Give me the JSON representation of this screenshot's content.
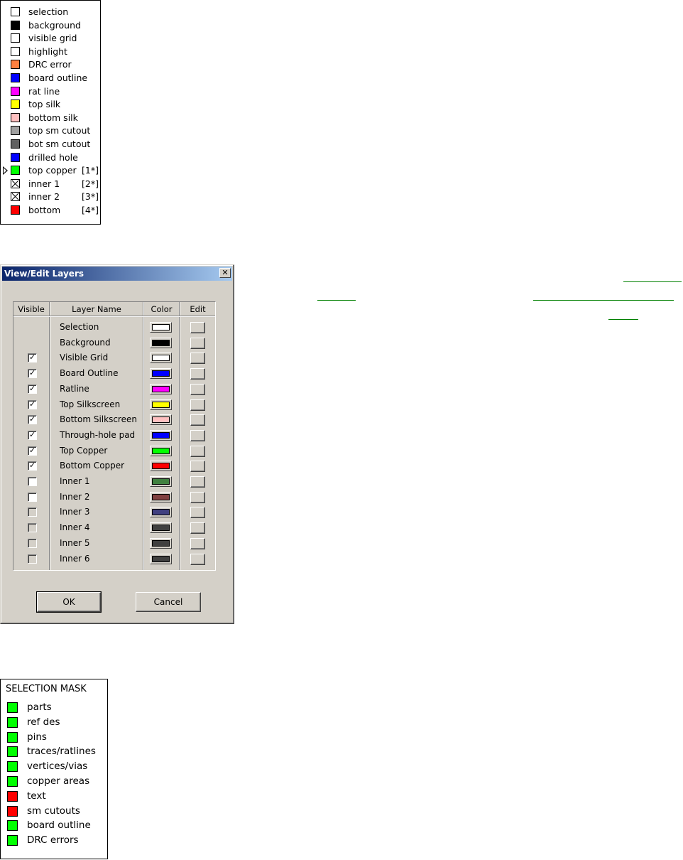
{
  "layers_legend": {
    "items": [
      {
        "label": "selection",
        "color": "#ffffff",
        "icon": "empty-swatch",
        "index": ""
      },
      {
        "label": "background",
        "color": "#000000",
        "icon": "color-swatch",
        "index": ""
      },
      {
        "label": "visible grid",
        "color": "#ffffff",
        "icon": "empty-swatch",
        "index": ""
      },
      {
        "label": "highlight",
        "color": "#ffffff",
        "icon": "empty-swatch",
        "index": ""
      },
      {
        "label": "DRC error",
        "color": "#ff8040",
        "icon": "color-swatch",
        "index": ""
      },
      {
        "label": "board outline",
        "color": "#0000ff",
        "icon": "color-swatch",
        "index": ""
      },
      {
        "label": "rat line",
        "color": "#ff00ff",
        "icon": "color-swatch",
        "index": ""
      },
      {
        "label": "top silk",
        "color": "#ffff00",
        "icon": "color-swatch",
        "index": ""
      },
      {
        "label": "bottom silk",
        "color": "#ffc0c0",
        "icon": "color-swatch",
        "index": ""
      },
      {
        "label": "top sm cutout",
        "color": "#a0a0a0",
        "icon": "color-swatch",
        "index": ""
      },
      {
        "label": "bot sm cutout",
        "color": "#606060",
        "icon": "color-swatch",
        "index": ""
      },
      {
        "label": "drilled hole",
        "color": "#0000ff",
        "icon": "color-swatch",
        "index": ""
      },
      {
        "label": "top copper",
        "color": "#00ff00",
        "icon": "color-swatch",
        "index": "[1*]",
        "active": true
      },
      {
        "label": "inner 1",
        "color": "#ffffff",
        "icon": "crossed-swatch",
        "index": "[2*]"
      },
      {
        "label": "inner 2",
        "color": "#ffffff",
        "icon": "crossed-swatch",
        "index": "[3*]"
      },
      {
        "label": "bottom",
        "color": "#ff0000",
        "icon": "color-swatch",
        "index": "[4*]"
      }
    ]
  },
  "dialog": {
    "title": "View/Edit Layers",
    "close_icon": "close-icon",
    "columns": {
      "visible": "Visible",
      "layer_name": "Layer Name",
      "color": "Color",
      "edit": "Edit"
    },
    "rows": [
      {
        "name": "Selection",
        "visible": null,
        "color": "#ffffff"
      },
      {
        "name": "Background",
        "visible": null,
        "color": "#000000"
      },
      {
        "name": "Visible Grid",
        "visible": true,
        "color": "#ffffff"
      },
      {
        "name": "Board Outline",
        "visible": true,
        "color": "#0000ff"
      },
      {
        "name": "Ratline",
        "visible": true,
        "color": "#ff00ff"
      },
      {
        "name": "Top Silkscreen",
        "visible": true,
        "color": "#ffff00"
      },
      {
        "name": "Bottom Silkscreen",
        "visible": true,
        "color": "#ffc0c0"
      },
      {
        "name": "Through-hole pad",
        "visible": true,
        "color": "#0000ff"
      },
      {
        "name": "Top Copper",
        "visible": true,
        "color": "#00ff00"
      },
      {
        "name": "Bottom Copper",
        "visible": true,
        "color": "#ff0000"
      },
      {
        "name": "Inner 1",
        "visible": false,
        "color": "#408040",
        "enabled": true
      },
      {
        "name": "Inner 2",
        "visible": false,
        "color": "#804040",
        "enabled": true
      },
      {
        "name": "Inner 3",
        "visible": false,
        "color": "#404080",
        "enabled": false
      },
      {
        "name": "Inner 4",
        "visible": false,
        "color": "#404040",
        "enabled": false
      },
      {
        "name": "Inner 5",
        "visible": false,
        "color": "#404040",
        "enabled": false
      },
      {
        "name": "Inner 6",
        "visible": false,
        "color": "#404040",
        "enabled": false
      }
    ],
    "ok_label": "OK",
    "cancel_label": "Cancel"
  },
  "selection_mask": {
    "title": "SELECTION MASK",
    "items": [
      {
        "label": "parts",
        "color": "#00ff00"
      },
      {
        "label": "ref des",
        "color": "#00ff00"
      },
      {
        "label": "pins",
        "color": "#00ff00"
      },
      {
        "label": "traces/ratlines",
        "color": "#00ff00"
      },
      {
        "label": "vertices/vias",
        "color": "#00ff00"
      },
      {
        "label": "copper areas",
        "color": "#00ff00"
      },
      {
        "label": "text",
        "color": "#ff0000"
      },
      {
        "label": "sm cutouts",
        "color": "#ff0000"
      },
      {
        "label": "board outline",
        "color": "#00ff00"
      },
      {
        "label": "DRC errors",
        "color": "#00ff00"
      }
    ]
  },
  "link_color": "#008000"
}
